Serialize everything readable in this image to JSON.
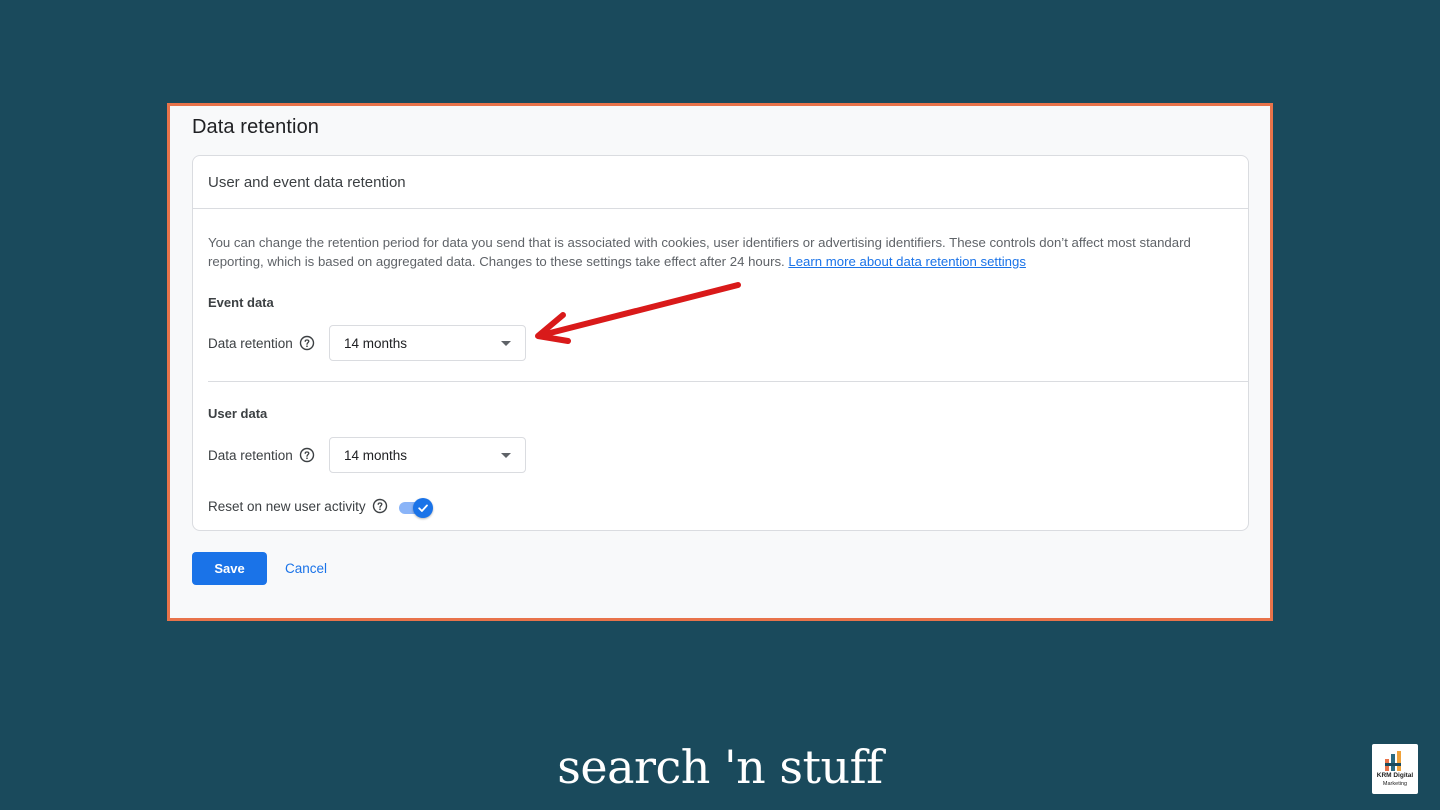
{
  "page_title": "Data retention",
  "card": {
    "header": "User and event data retention",
    "description": "You can change the retention period for data you send that is associated with cookies, user identifiers or advertising identifiers. These controls don’t affect most standard reporting, which is based on aggregated data. Changes to these settings take effect after 24 hours.",
    "learn_more_link": "Learn more about data retention settings",
    "event_section": {
      "heading": "Event data",
      "retention_label": "Data retention",
      "retention_value": "14 months"
    },
    "user_section": {
      "heading": "User data",
      "retention_label": "Data retention",
      "retention_value": "14 months",
      "reset_label": "Reset on new user activity",
      "reset_enabled": true
    }
  },
  "actions": {
    "save_label": "Save",
    "cancel_label": "Cancel"
  },
  "footer": {
    "brand_wordmark": "search 'n stuff",
    "logo_line1": "KRM Digital",
    "logo_line2": "Marketing"
  },
  "colors": {
    "background": "#1a4a5c",
    "frame_border": "#e8734a",
    "primary": "#1a73e8",
    "annotation_arrow": "#d91a1a"
  }
}
